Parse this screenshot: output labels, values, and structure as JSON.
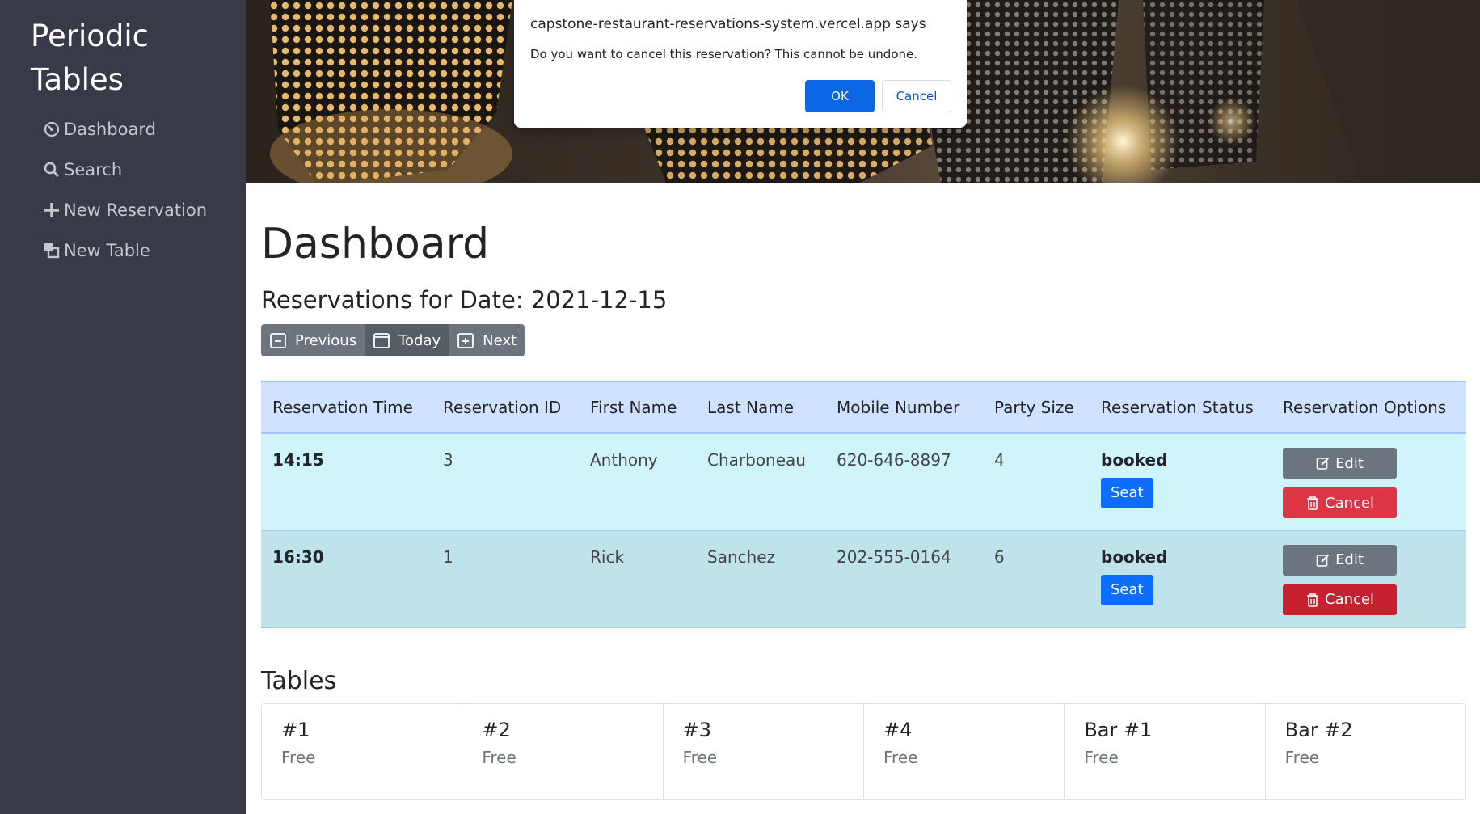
{
  "sidebar": {
    "brand": "Periodic Tables",
    "items": [
      {
        "label": "Dashboard",
        "icon": "dashboard-icon"
      },
      {
        "label": "Search",
        "icon": "search-icon"
      },
      {
        "label": "New Reservation",
        "icon": "plus-icon"
      },
      {
        "label": "New Table",
        "icon": "tables-icon"
      }
    ]
  },
  "main": {
    "title": "Dashboard",
    "date_heading": "Reservations for Date: 2021-12-15",
    "date_nav": {
      "previous": "Previous",
      "today": "Today",
      "next": "Next"
    },
    "reservations": {
      "headers": [
        "Reservation Time",
        "Reservation ID",
        "First Name",
        "Last Name",
        "Mobile Number",
        "Party Size",
        "Reservation Status",
        "Reservation Options"
      ],
      "rows": [
        {
          "time": "14:15",
          "id": "3",
          "first_name": "Anthony",
          "last_name": "Charboneau",
          "mobile": "620-646-8897",
          "party_size": "4",
          "status": "booked",
          "seat_label": "Seat",
          "edit_label": "Edit",
          "cancel_label": "Cancel"
        },
        {
          "time": "16:30",
          "id": "1",
          "first_name": "Rick",
          "last_name": "Sanchez",
          "mobile": "202-555-0164",
          "party_size": "6",
          "status": "booked",
          "seat_label": "Seat",
          "edit_label": "Edit",
          "cancel_label": "Cancel"
        }
      ]
    },
    "tables_heading": "Tables",
    "tables": [
      {
        "name": "#1",
        "status": "Free"
      },
      {
        "name": "#2",
        "status": "Free"
      },
      {
        "name": "#3",
        "status": "Free"
      },
      {
        "name": "#4",
        "status": "Free"
      },
      {
        "name": "Bar #1",
        "status": "Free"
      },
      {
        "name": "Bar #2",
        "status": "Free"
      }
    ]
  },
  "dialog": {
    "title": "capstone-restaurant-reservations-system.vercel.app says",
    "message": "Do you want to cancel this reservation? This cannot be undone.",
    "ok": "OK",
    "cancel": "Cancel"
  },
  "colors": {
    "sidebar_bg": "#383a47",
    "header_row": "#cfe2ff",
    "row_a": "#cff4fc",
    "row_b": "#bfe3ea",
    "primary": "#0d6efd",
    "danger": "#dc3545",
    "secondary": "#6c757d"
  }
}
